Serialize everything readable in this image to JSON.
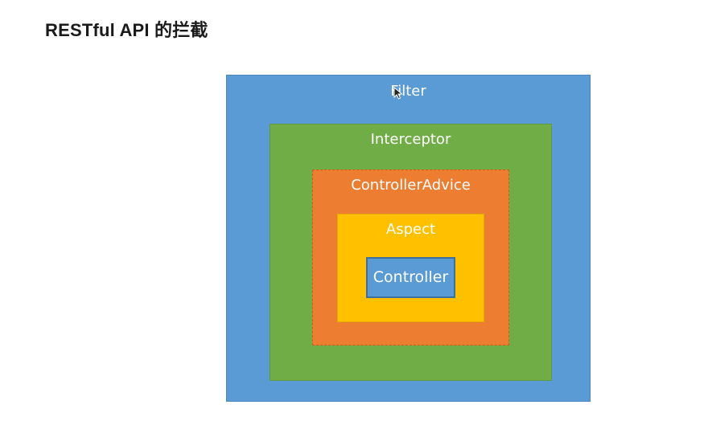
{
  "page": {
    "title": "RESTful API 的拦截"
  },
  "diagram": {
    "layers": [
      {
        "id": "filter",
        "label": "Filter",
        "color": "#5b9bd5"
      },
      {
        "id": "interceptor",
        "label": "Interceptor",
        "color": "#70ad47"
      },
      {
        "id": "controller_advice",
        "label": "ControllerAdvice",
        "color": "#ed7d31"
      },
      {
        "id": "aspect",
        "label": "Aspect",
        "color": "#ffc000"
      },
      {
        "id": "controller",
        "label": "Controller",
        "color": "#5b9bd5"
      }
    ]
  }
}
